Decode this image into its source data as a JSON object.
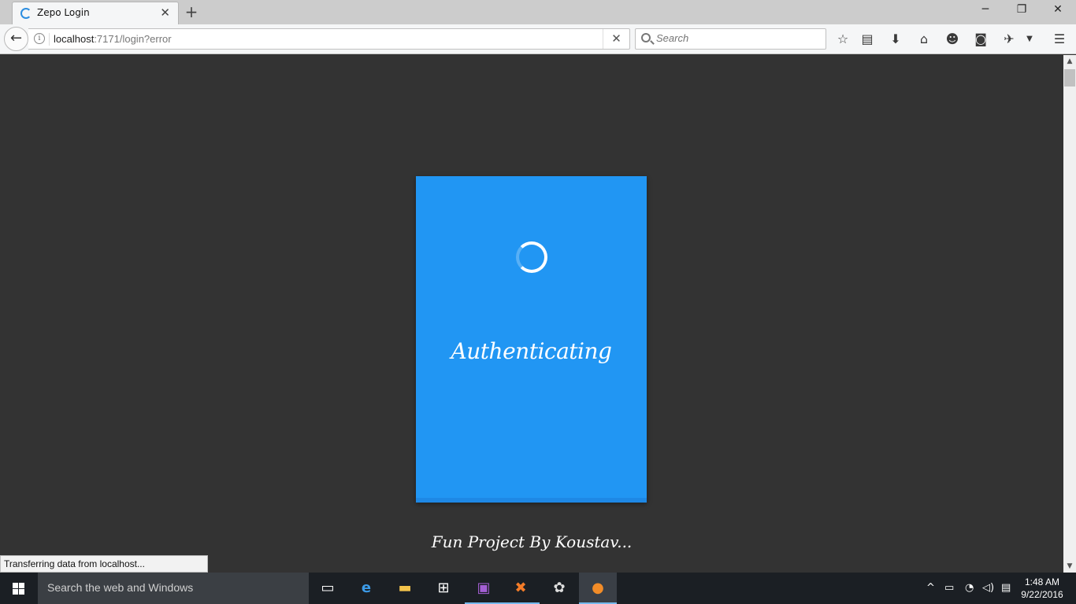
{
  "browser": {
    "tab_title": "Zepo Login",
    "url_host": "localhost",
    "url_rest": ":7171/login?error",
    "search_placeholder": "Search",
    "status_text": "Transferring data from localhost..."
  },
  "page": {
    "loading_text": "Authenticating",
    "footer_text": "Fun Project By Koustav...",
    "card_color": "#2196f3",
    "background_color": "#333333"
  },
  "taskbar": {
    "search_placeholder": "Search the web and Windows",
    "time": "1:48 AM",
    "date": "9/22/2016"
  }
}
